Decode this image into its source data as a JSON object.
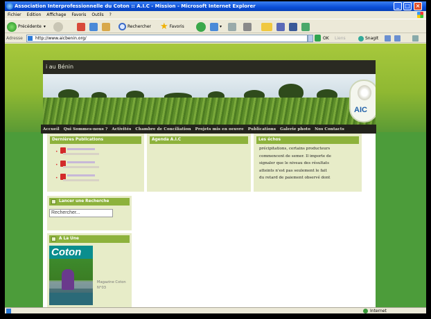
{
  "window": {
    "title": "Association Interprofessionnelle du Coton :: A.I.C - Mission - Microsoft Internet Explorer"
  },
  "menu": [
    "Fichier",
    "Edition",
    "Affichage",
    "Favoris",
    "Outils",
    "?"
  ],
  "toolbar": {
    "back_label": "Précédente",
    "search_label": "Rechercher",
    "favorites_label": "Favoris"
  },
  "addressbar": {
    "label": "Adresse",
    "url": "http://www.aicbenin.org/",
    "go_label": "OK",
    "links_label": "Liens",
    "snagit_label": "SnagIt"
  },
  "site": {
    "title": "i au Bénin",
    "logo_text": "AIC",
    "nav": [
      "Accueil",
      "Qui Sommes-nous ?",
      "Activités",
      "Chambre de Conciliation",
      "Projets mis en oeuvre",
      "Publications",
      "Galerie photo",
      "Nos Contacts"
    ],
    "columns": {
      "publications_head": "Dernières Publications",
      "agenda_head": "Agenda A.I.C",
      "news_head": "Les échos",
      "news_lines": [
        "précipitations, certains producteurs",
        "commencent de semer. Il importe de",
        "signaler que le niveau des résultats",
        "atteints n'est pas seulement le fait",
        "du retard de paiement observé dont"
      ]
    },
    "sidebar": {
      "search_head": "Lancer une Recherche",
      "search_placeholder": "Rechercher...",
      "alaune_head": "A La Une",
      "magazine_title": "Coton",
      "magazine_caption": "Magazine Coton N°03"
    }
  },
  "statusbar": {
    "zone": "Internet"
  },
  "colors": {
    "titlebar": "#0a4ed8",
    "site_header": "#2a2a22",
    "green_dark": "#4c9c3a",
    "green_light": "#9ec23a",
    "box_head": "#8db23c",
    "box_bg": "#e7ecc8"
  }
}
